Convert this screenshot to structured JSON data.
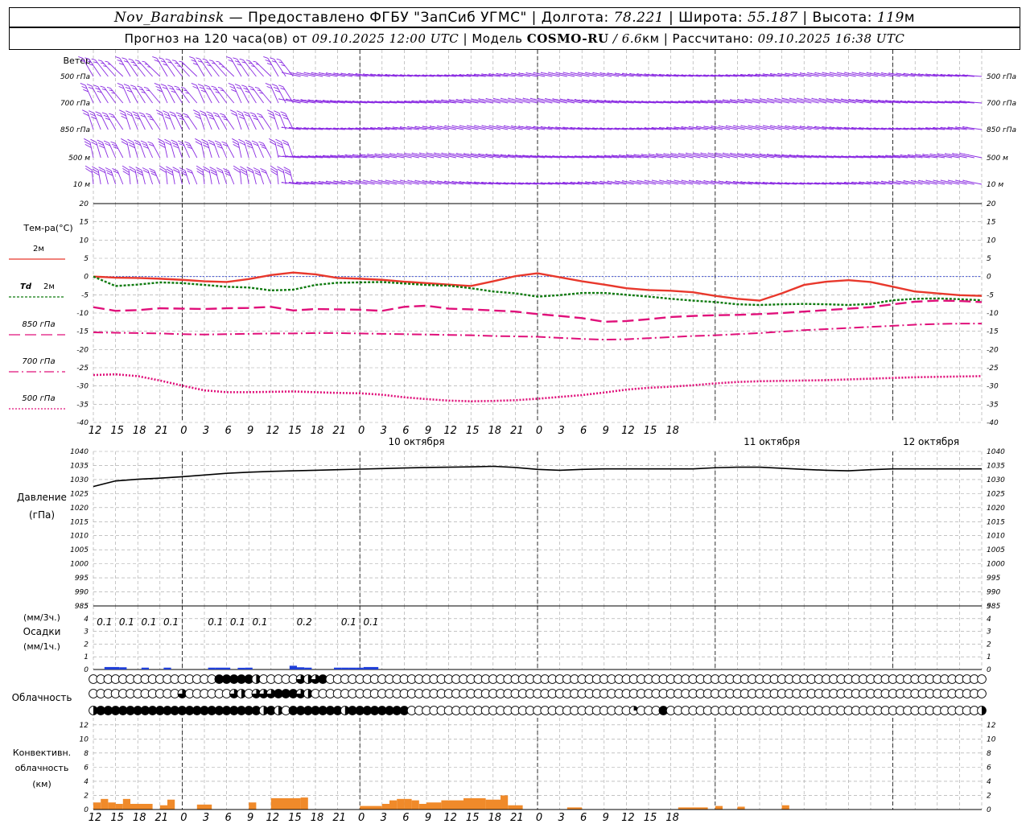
{
  "header": {
    "station": "Nov_Barabinsk",
    "sep1": " — Предоставлено ФГБУ \"ЗапСиб УГМС\" | Долгота: ",
    "lon": "78.221",
    "sep2": " | Широта: ",
    "lat": "55.187",
    "sep3": " | Высота: ",
    "alt": "119",
    "alt_unit": "м",
    "forecast_label": "Прогноз на 120 часа(ов) от ",
    "issued": "09.10.2025 12:00 UTC",
    "model_label": " | Модель ",
    "model": "COSMO-RU",
    "model_res": " / 6.6",
    "model_res_unit": "км",
    "calc_label": " | Рассчитано: ",
    "calculated": "09.10.2025 16:38 UTC"
  },
  "colors": {
    "wind": "#8a2be2",
    "t2m": "#e8382c",
    "td2m": "#0f7a0f",
    "t850": "#e0107a",
    "t700": "#e0107a",
    "t500": "#e0107a",
    "zero_line": "#2a3fd0",
    "pressure": "#000000",
    "precip": "#1f3fd8",
    "convective": "#f08a2a",
    "grid": "#a0a0a0"
  },
  "chart_data": [
    {
      "type": "barbs",
      "title": "Ветер",
      "levels": [
        "500 гПа",
        "700 гПа",
        "850 гПа",
        "500 м",
        "10 м"
      ],
      "x_hours": [
        0,
        120
      ]
    },
    {
      "type": "line",
      "title": "Тем-ра(°С)",
      "ylim": [
        -40,
        20
      ],
      "yticks": [
        20,
        15,
        10,
        5,
        0,
        -5,
        -10,
        -15,
        -20,
        -25,
        -30,
        -35,
        -40
      ],
      "x_tick_labels": [
        "12",
        "15",
        "18",
        "21",
        "0",
        "3",
        "6",
        "9",
        "12",
        "15",
        "18",
        "21",
        "0",
        "3",
        "6",
        "9",
        "12",
        "15",
        "18",
        "21",
        "0",
        "3",
        "6",
        "9",
        "12",
        "15",
        "18"
      ],
      "date_labels": [
        "10 октября",
        "11 октября",
        "12 октября"
      ],
      "legend": [
        {
          "id": "t2m",
          "label": "2м"
        },
        {
          "id": "td2m",
          "label_prefix": "Td",
          "label": "2м"
        },
        {
          "id": "t850",
          "label": "850 гПа"
        },
        {
          "id": "t700",
          "label": "700 гПа"
        },
        {
          "id": "t500",
          "label": "500 гПа"
        }
      ],
      "x": [
        0,
        3,
        6,
        9,
        12,
        15,
        18,
        21,
        24,
        27,
        30,
        33,
        36,
        39,
        42,
        45,
        48,
        51,
        54,
        57,
        60,
        63,
        66,
        69,
        72,
        75,
        78,
        81,
        84,
        87,
        90,
        93,
        96,
        99,
        102,
        105,
        108,
        111,
        114,
        117,
        120
      ],
      "series": [
        {
          "id": "t2m",
          "values": [
            0,
            -0.3,
            -0.4,
            -0.6,
            -0.9,
            -1.3,
            -1.5,
            -0.7,
            0.4,
            1.1,
            0.6,
            -0.4,
            -0.6,
            -0.9,
            -1.4,
            -1.8,
            -2.2,
            -2.6,
            -1.3,
            0.1,
            0.9,
            -0.2,
            -1.3,
            -2.2,
            -3.2,
            -3.7,
            -3.9,
            -4.3,
            -5.3,
            -6.1,
            -6.6,
            -4.6,
            -2.3,
            -1.4,
            -1.0,
            -1.5,
            -2.8,
            -4.1,
            -4.6,
            -5.1,
            -5.3
          ]
        },
        {
          "id": "td2m",
          "values": [
            0,
            -2.6,
            -2.2,
            -1.6,
            -1.8,
            -2.3,
            -2.8,
            -3.0,
            -3.8,
            -3.6,
            -2.3,
            -1.7,
            -1.6,
            -1.5,
            -1.9,
            -2.3,
            -2.5,
            -3.2,
            -4.1,
            -4.6,
            -5.5,
            -5.1,
            -4.5,
            -4.5,
            -5.0,
            -5.5,
            -6.1,
            -6.6,
            -7.0,
            -7.6,
            -7.8,
            -7.6,
            -7.5,
            -7.6,
            -7.8,
            -7.5,
            -6.5,
            -6.1,
            -6.0,
            -6.2,
            -6.5
          ]
        },
        {
          "id": "t850",
          "values": [
            -8.4,
            -9.4,
            -9.2,
            -8.7,
            -8.8,
            -8.9,
            -8.7,
            -8.6,
            -8.3,
            -9.3,
            -8.9,
            -9.0,
            -9.1,
            -9.4,
            -8.3,
            -8.0,
            -8.8,
            -9.0,
            -9.3,
            -9.6,
            -10.3,
            -10.8,
            -11.4,
            -12.4,
            -12.2,
            -11.7,
            -11.1,
            -10.8,
            -10.6,
            -10.5,
            -10.3,
            -10.0,
            -9.6,
            -9.2,
            -8.8,
            -8.4,
            -7.6,
            -6.9,
            -6.6,
            -6.7,
            -7.0
          ]
        },
        {
          "id": "t700",
          "values": [
            -15.3,
            -15.4,
            -15.5,
            -15.6,
            -15.8,
            -15.9,
            -15.8,
            -15.7,
            -15.6,
            -15.6,
            -15.5,
            -15.5,
            -15.6,
            -15.7,
            -15.8,
            -15.9,
            -16.0,
            -16.1,
            -16.3,
            -16.4,
            -16.5,
            -16.8,
            -17.1,
            -17.3,
            -17.2,
            -16.9,
            -16.6,
            -16.3,
            -16.1,
            -15.8,
            -15.5,
            -15.1,
            -14.7,
            -14.4,
            -14.1,
            -13.8,
            -13.5,
            -13.2,
            -13.0,
            -12.9,
            -12.9
          ]
        },
        {
          "id": "t500",
          "values": [
            -27.0,
            -26.8,
            -27.3,
            -28.5,
            -29.9,
            -31.2,
            -31.7,
            -31.7,
            -31.6,
            -31.5,
            -31.7,
            -31.9,
            -32.0,
            -32.4,
            -33.1,
            -33.6,
            -34.0,
            -34.2,
            -34.1,
            -33.9,
            -33.5,
            -33.0,
            -32.5,
            -31.8,
            -31.0,
            -30.5,
            -30.2,
            -29.8,
            -29.3,
            -28.9,
            -28.7,
            -28.6,
            -28.5,
            -28.4,
            -28.2,
            -28.0,
            -27.8,
            -27.6,
            -27.5,
            -27.4,
            -27.3
          ]
        }
      ]
    },
    {
      "type": "line",
      "title": "Давление",
      "unit": "(гПа)",
      "ylim": [
        985,
        1040
      ],
      "yticks": [
        1040,
        1035,
        1030,
        1025,
        1020,
        1015,
        1010,
        1005,
        1000,
        995,
        990,
        985
      ],
      "x": [
        0,
        3,
        6,
        9,
        12,
        15,
        18,
        21,
        24,
        27,
        30,
        33,
        36,
        39,
        42,
        45,
        48,
        51,
        54,
        57,
        60,
        63,
        66,
        69,
        72,
        75,
        78,
        81,
        84,
        87,
        90,
        93,
        96,
        99,
        102,
        105,
        108,
        111,
        114,
        117,
        120
      ],
      "values": [
        1027.5,
        1029.5,
        1030.1,
        1030.5,
        1031.0,
        1031.6,
        1032.2,
        1032.6,
        1032.9,
        1033.1,
        1033.3,
        1033.5,
        1033.7,
        1033.9,
        1034.1,
        1034.3,
        1034.4,
        1034.5,
        1034.7,
        1034.3,
        1033.6,
        1033.3,
        1033.6,
        1033.8,
        1033.8,
        1033.8,
        1033.8,
        1033.8,
        1034.2,
        1034.4,
        1034.4,
        1034.0,
        1033.6,
        1033.3,
        1033.1,
        1033.5,
        1033.8,
        1033.8,
        1033.8,
        1033.8,
        1033.8
      ]
    },
    {
      "type": "bar",
      "title": "Осадки",
      "unit_top": "(мм/3ч.)",
      "unit_bottom": "(мм/1ч.)",
      "ylim": [
        0,
        5
      ],
      "yticks": [
        5,
        4,
        3,
        2,
        1,
        0
      ],
      "labels_3h": [
        {
          "x": 1.5,
          "text": "0.1"
        },
        {
          "x": 4.5,
          "text": "0.1"
        },
        {
          "x": 7.5,
          "text": "0.1"
        },
        {
          "x": 10.5,
          "text": "0.1"
        },
        {
          "x": 16.5,
          "text": "0.1"
        },
        {
          "x": 19.5,
          "text": "0.1"
        },
        {
          "x": 22.5,
          "text": "0.1"
        },
        {
          "x": 28.5,
          "text": "0.2"
        },
        {
          "x": 34.5,
          "text": "0.1"
        },
        {
          "x": 37.5,
          "text": "0.1"
        }
      ],
      "hourly": [
        {
          "x": 2,
          "v": 0.1
        },
        {
          "x": 3,
          "v": 0.1
        },
        {
          "x": 4,
          "v": 0.08
        },
        {
          "x": 7,
          "v": 0.05
        },
        {
          "x": 10,
          "v": 0.05
        },
        {
          "x": 16,
          "v": 0.05
        },
        {
          "x": 17,
          "v": 0.05
        },
        {
          "x": 18,
          "v": 0.05
        },
        {
          "x": 20,
          "v": 0.04
        },
        {
          "x": 21,
          "v": 0.05
        },
        {
          "x": 27,
          "v": 0.2
        },
        {
          "x": 28,
          "v": 0.08
        },
        {
          "x": 29,
          "v": 0.05
        },
        {
          "x": 33,
          "v": 0.05
        },
        {
          "x": 34,
          "v": 0.05
        },
        {
          "x": 35,
          "v": 0.05
        },
        {
          "x": 36,
          "v": 0.05
        },
        {
          "x": 37,
          "v": 0.1
        },
        {
          "x": 38,
          "v": 0.1
        }
      ]
    },
    {
      "type": "table",
      "title": "Облачность",
      "rows": [
        {
          "level": "upper",
          "cover": [
            0,
            0,
            0,
            0,
            0,
            0,
            0,
            0,
            0,
            0,
            0,
            0,
            0,
            0,
            0,
            0,
            0,
            8,
            8,
            8,
            8,
            8,
            4,
            0,
            0,
            0,
            0,
            0,
            6,
            4,
            6,
            8,
            0,
            0,
            0,
            0,
            0,
            0,
            0,
            0,
            0,
            0,
            0,
            0,
            0,
            0,
            0,
            0,
            0,
            0,
            0,
            0,
            0,
            0,
            0,
            0,
            0,
            0,
            0,
            0,
            0,
            0,
            0,
            0,
            0,
            0,
            0,
            0,
            0,
            0,
            0,
            0,
            0,
            0,
            0,
            0,
            0,
            0,
            0,
            0,
            0,
            0,
            0,
            0,
            0,
            0,
            0,
            0,
            0,
            0,
            0,
            0,
            0,
            0,
            0,
            0,
            0,
            0,
            0,
            0,
            0,
            0,
            0,
            0,
            0,
            0,
            0,
            0,
            0,
            0,
            0,
            0,
            0,
            0,
            0,
            0,
            0,
            0,
            0,
            0,
            0
          ]
        },
        {
          "level": "middle",
          "cover": [
            0,
            0,
            0,
            0,
            0,
            0,
            0,
            0,
            0,
            0,
            0,
            0,
            6,
            0,
            0,
            0,
            0,
            0,
            0,
            6,
            4,
            0,
            6,
            6,
            6,
            8,
            8,
            8,
            6,
            4,
            0,
            0,
            0,
            0,
            0,
            0,
            0,
            0,
            0,
            0,
            0,
            0,
            0,
            0,
            0,
            0,
            0,
            0,
            0,
            0,
            0,
            0,
            0,
            0,
            0,
            0,
            0,
            0,
            0,
            0,
            0,
            0,
            0,
            0,
            0,
            0,
            0,
            0,
            0,
            0,
            0,
            0,
            0,
            0,
            0,
            0,
            0,
            0,
            0,
            0,
            0,
            0,
            0,
            0,
            0,
            0,
            0,
            0,
            0,
            0,
            0,
            0,
            0,
            0,
            0,
            0,
            0,
            0,
            0,
            0,
            0,
            0,
            0,
            0,
            0,
            0,
            0,
            0,
            0,
            0,
            0,
            0,
            0,
            0,
            0,
            0,
            0,
            0,
            0,
            0,
            0
          ]
        },
        {
          "level": "lower",
          "cover": [
            4,
            8,
            8,
            8,
            8,
            8,
            8,
            8,
            8,
            8,
            8,
            8,
            8,
            8,
            8,
            8,
            8,
            8,
            8,
            8,
            8,
            8,
            8,
            4,
            8,
            4,
            0,
            8,
            8,
            8,
            8,
            8,
            8,
            8,
            4,
            8,
            8,
            8,
            8,
            8,
            8,
            8,
            8,
            0,
            0,
            0,
            0,
            0,
            0,
            0,
            0,
            0,
            0,
            0,
            0,
            0,
            0,
            0,
            0,
            0,
            0,
            0,
            0,
            0,
            0,
            0,
            0,
            0,
            0,
            0,
            0,
            0,
            0,
            2,
            0,
            0,
            0,
            8,
            0,
            0,
            0,
            0,
            0,
            0,
            0,
            0,
            0,
            0,
            0,
            0,
            0,
            0,
            0,
            0,
            0,
            0,
            0,
            0,
            0,
            0,
            0,
            0,
            0,
            0,
            0,
            0,
            0,
            0,
            0,
            0,
            0,
            0,
            0,
            0,
            0,
            0,
            0,
            0,
            0,
            0,
            4
          ]
        }
      ]
    },
    {
      "type": "bar",
      "title": "Конвективн.",
      "subtitle": "облачность",
      "unit": "(км)",
      "ylim": [
        0,
        13
      ],
      "yticks": [
        12,
        10,
        8,
        6,
        4,
        2,
        0
      ],
      "bars": [
        {
          "x0": 0,
          "x1": 1,
          "h": 1.0
        },
        {
          "x0": 1,
          "x1": 2,
          "h": 1.5
        },
        {
          "x0": 2,
          "x1": 3,
          "h": 1.0
        },
        {
          "x0": 3,
          "x1": 4,
          "h": 0.8
        },
        {
          "x0": 4,
          "x1": 5,
          "h": 1.5
        },
        {
          "x0": 5,
          "x1": 8,
          "h": 0.8
        },
        {
          "x0": 9,
          "x1": 10,
          "h": 0.6
        },
        {
          "x0": 10,
          "x1": 11,
          "h": 1.4
        },
        {
          "x0": 14,
          "x1": 16,
          "h": 0.7
        },
        {
          "x0": 21,
          "x1": 22,
          "h": 1.0
        },
        {
          "x0": 24,
          "x1": 28,
          "h": 1.6
        },
        {
          "x0": 28,
          "x1": 29,
          "h": 1.7
        },
        {
          "x0": 40,
          "x1": 41,
          "h": 1.3
        },
        {
          "x0": 41,
          "x1": 42,
          "h": 1.5
        },
        {
          "x0": 42,
          "x1": 43,
          "h": 1.5
        },
        {
          "x0": 43,
          "x1": 44,
          "h": 1.3
        },
        {
          "x0": 36,
          "x1": 39,
          "h": 0.5
        },
        {
          "x0": 39,
          "x1": 40,
          "h": 0.8
        },
        {
          "x0": 44,
          "x1": 45,
          "h": 0.8
        },
        {
          "x0": 45,
          "x1": 47,
          "h": 1.0
        },
        {
          "x0": 47,
          "x1": 50,
          "h": 1.3
        },
        {
          "x0": 50,
          "x1": 53,
          "h": 1.6
        },
        {
          "x0": 53,
          "x1": 55,
          "h": 1.4
        },
        {
          "x0": 55,
          "x1": 56,
          "h": 2.0
        },
        {
          "x0": 56,
          "x1": 58,
          "h": 0.6
        },
        {
          "x0": 64,
          "x1": 66,
          "h": 0.3
        },
        {
          "x0": 79,
          "x1": 83,
          "h": 0.3
        },
        {
          "x0": 84,
          "x1": 85,
          "h": 0.5
        },
        {
          "x0": 87,
          "x1": 88,
          "h": 0.4
        },
        {
          "x0": 93,
          "x1": 94,
          "h": 0.6
        }
      ]
    }
  ]
}
